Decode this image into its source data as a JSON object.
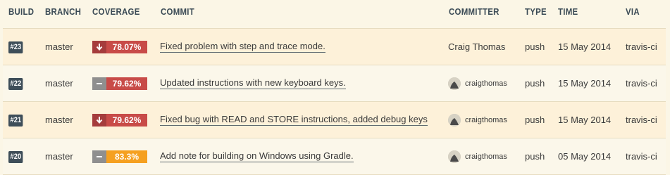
{
  "headers": {
    "build": "BUILD",
    "branch": "BRANCH",
    "coverage": "COVERAGE",
    "commit": "COMMIT",
    "committer": "COMMITTER",
    "type": "TYPE",
    "time": "TIME",
    "via": "VIA"
  },
  "builds": [
    {
      "build": "#23",
      "branch": "master",
      "coverage": "78.07%",
      "trend": "down",
      "trend_icon": "arrow-down-icon",
      "commit": "Fixed problem with step and trace mode.",
      "committer": "Craig Thomas",
      "type": "push",
      "time": "15 May 2014",
      "via": "travis-ci"
    },
    {
      "build": "#22",
      "branch": "master",
      "coverage": "79.62%",
      "trend": "flat",
      "trend_icon": "dash-icon",
      "commit": "Updated instructions with new keyboard keys.",
      "committer": "craigthomas",
      "type": "push",
      "time": "15 May 2014",
      "via": "travis-ci"
    },
    {
      "build": "#21",
      "branch": "master",
      "coverage": "79.62%",
      "trend": "down",
      "trend_icon": "arrow-down-icon",
      "commit": "Fixed bug with READ and STORE instructions, added debug keys",
      "committer": "craigthomas",
      "type": "push",
      "time": "15 May 2014",
      "via": "travis-ci"
    },
    {
      "build": "#20",
      "branch": "master",
      "coverage": "83.3%",
      "trend": "flat",
      "trend_icon": "dash-icon",
      "commit": "Add note for building on Windows using Gradle.",
      "committer": "craigthomas",
      "type": "push",
      "time": "05 May 2014",
      "via": "travis-ci"
    }
  ],
  "colors": {
    "badge": "#3e4e59",
    "coverage_low": "#c84b48",
    "coverage_mid": "#f5a020",
    "trend_down": "#a53c3c",
    "trend_flat": "#8f8f8f"
  }
}
